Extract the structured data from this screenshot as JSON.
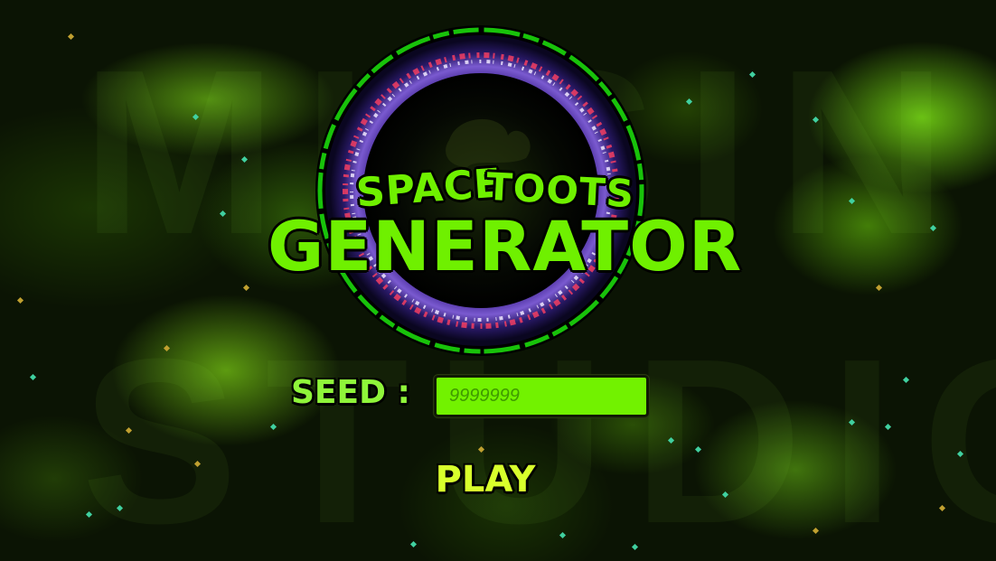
{
  "title": {
    "word_space": "SPACE",
    "word_toots": "TOOTS",
    "word_generator": "GENERATOR"
  },
  "seed": {
    "label": "SEED :",
    "placeholder": "9999999",
    "value": ""
  },
  "play_button": {
    "label": "PLAY"
  },
  "background_watermark": {
    "top": "MUSIN",
    "bottom": "STUDIO"
  },
  "colors": {
    "title_green": "#6ff000",
    "input_fill": "#72f200",
    "input_text": "#3f9a00",
    "play_yellow": "#d8ff2c",
    "ring_outer": "#18c20a",
    "ring_inner": "#2a1a6a",
    "ring_sparks": "#ff4060"
  },
  "icons": {
    "emblem": "portal-ring-icon"
  }
}
